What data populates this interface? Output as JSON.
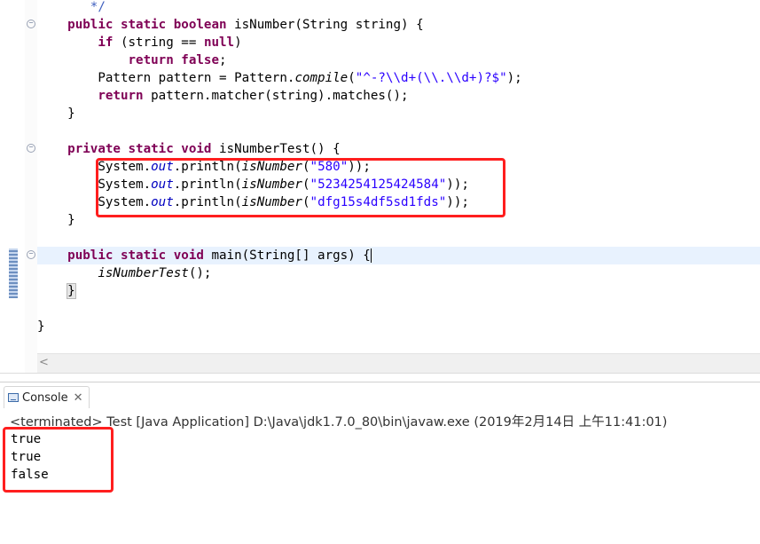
{
  "editor": {
    "lines": {
      "l0": " */",
      "l1_kw": "public static boolean ",
      "l1_rest": "isNumber(String string) {",
      "l2_kw": "if ",
      "l2_a": "(string == ",
      "l2_null": "null",
      "l2_b": ")",
      "l3_kw": "return false",
      "l3_b": ";",
      "l4_a": "Pattern pattern = Pattern.",
      "l4_m": "compile",
      "l4_b": "(",
      "l4_s": "\"^-?\\\\d+(\\\\.\\\\d+)?$\"",
      "l4_c": ");",
      "l5_kw": "return ",
      "l5_rest": "pattern.matcher(string).matches();",
      "l6": "}",
      "l8_kw": "private static void ",
      "l8_rest": "isNumberTest() {",
      "sys": "System.",
      "out": "out",
      "println": ".println(",
      "isnum": "isNumber",
      "paren": "(",
      "s1": "\"580\"",
      "s2": "\"5234254125424584\"",
      "s3": "\"dfg15s4df5sd1fds\"",
      "close": "));",
      "l12": "}",
      "l14_kw": "public static void ",
      "l14_rest": "main(String[] args) {",
      "l15_call": "isNumberTest",
      "l15_rest": "();",
      "l16": "}",
      "l18": "}"
    }
  },
  "console": {
    "tab_label": "Console",
    "tab_close": "✕",
    "status": "<terminated> Test [Java Application] D:\\Java\\jdk1.7.0_80\\bin\\javaw.exe (2019年2月14日 上午11:41:01)",
    "output": [
      "true",
      "true",
      "false"
    ]
  },
  "icons": {
    "console": "console-icon",
    "fold": "fold-minus-icon",
    "scroll_left": "chevron-left-icon"
  },
  "colors": {
    "keyword": "#7f0055",
    "string": "#2a00ff",
    "field": "#0000c0",
    "highlight_box": "#ff1e1e",
    "current_line": "#e8f2fe"
  }
}
